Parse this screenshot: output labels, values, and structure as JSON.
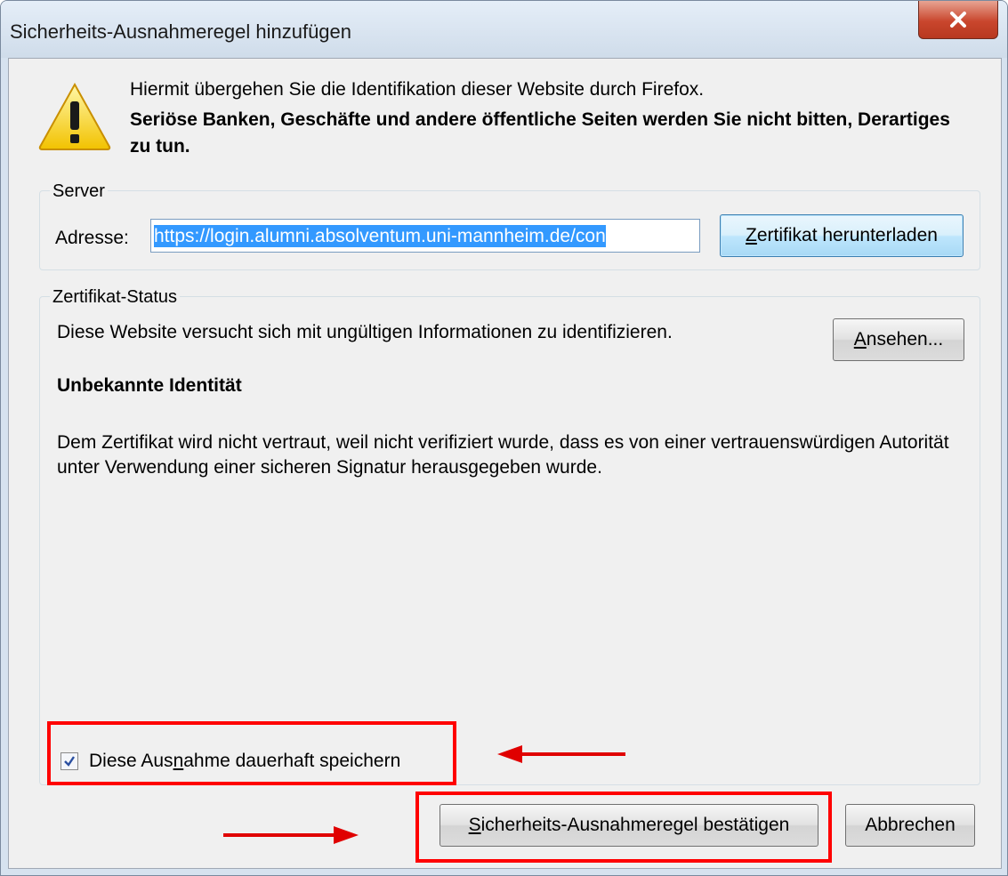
{
  "window": {
    "title": "Sicherheits-Ausnahmeregel hinzufügen",
    "close_label": "x"
  },
  "intro": {
    "line1": "Hiermit übergehen Sie die Identifikation dieser Website durch Firefox.",
    "line2": "Seriöse Banken, Geschäfte und andere öffentliche Seiten werden Sie nicht bitten, Derartiges zu tun."
  },
  "server": {
    "group_label": "Server",
    "address_label": "Adresse:",
    "address_value": "https://login.alumni.absolventum.uni-mannheim.de/con",
    "download_button_rest": "ertifikat herunterladen",
    "download_button_mnemonic": "Z"
  },
  "status": {
    "group_label": "Zertifikat-Status",
    "text": "Diese Website versucht sich mit ungültigen Informationen zu identifizieren.",
    "view_button_mnemonic": "A",
    "view_button_rest": "nsehen...",
    "unknown_title": "Unbekannte Identität",
    "description": "Dem Zertifikat wird nicht vertraut, weil nicht verifiziert wurde, dass es von einer vertrauenswürdigen Autorität unter Verwendung einer sicheren Signatur herausgegeben wurde."
  },
  "persist": {
    "checked": true,
    "label_pre": "Diese Aus",
    "label_mnemonic": "n",
    "label_post": "ahme dauerhaft speichern"
  },
  "actions": {
    "confirm_mnemonic": "S",
    "confirm_rest": "icherheits-Ausnahmeregel bestätigen",
    "cancel_label": "Abbrechen"
  },
  "colors": {
    "highlight": "#ff0000",
    "selection": "#3399ff"
  }
}
